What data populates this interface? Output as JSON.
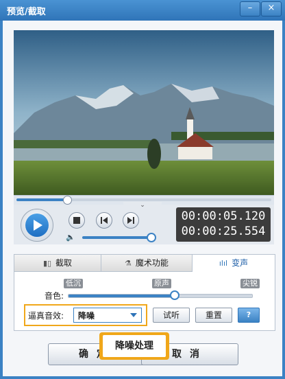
{
  "window": {
    "title": "预览/截取",
    "minimize_glyph": "–",
    "close_glyph": "×",
    "accent": "#3b82c4"
  },
  "player": {
    "collapse_glyph": "⌄",
    "current_time": "00:00:05.120",
    "total_time": "00:00:25.554",
    "seek_progress": 0.2,
    "volume_level": 0.93,
    "icons": {
      "play": "play-icon",
      "stop": "stop-icon",
      "prev": "prev-frame-icon",
      "next": "next-frame-icon",
      "volume": "volume-icon"
    }
  },
  "tabs": [
    {
      "label": "截取",
      "icon": "clip-icon",
      "active": false
    },
    {
      "label": "魔术功能",
      "icon": "magic-icon",
      "active": false
    },
    {
      "label": "变声",
      "icon": "soundwave-icon",
      "active": true
    }
  ],
  "voice": {
    "level_low": "低沉",
    "level_mid": "原声",
    "level_high": "尖锐",
    "pitch_label": "音色:",
    "pitch_value": 0.58,
    "effect_label": "逼真音效:",
    "effect_selected": "降噪",
    "preview_button": "试听",
    "reset_button": "重置",
    "help_icon": "help-icon"
  },
  "buttons": {
    "ok": "确定",
    "cancel": "取消"
  },
  "tooltip": {
    "text": "降噪处理",
    "color": "#f0a71a"
  }
}
